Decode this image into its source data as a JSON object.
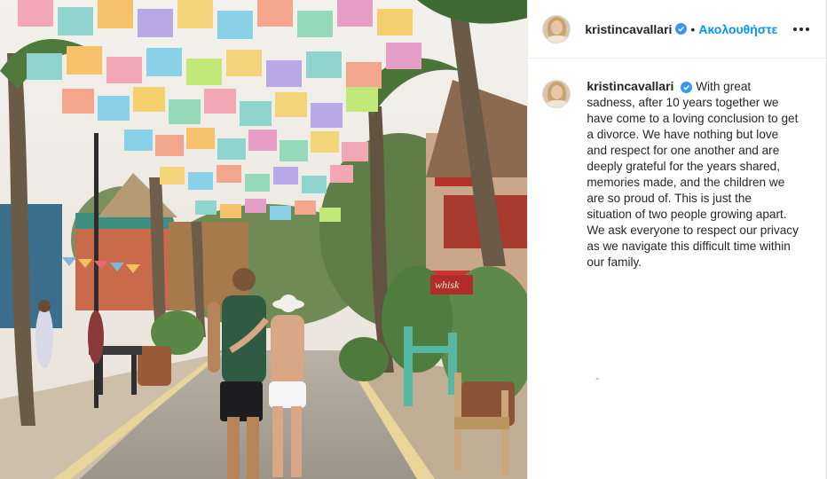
{
  "post": {
    "username": "kristincavallari",
    "follow_label": "Ακολουθήστε",
    "caption": "With great sadness, after 10 years together we have come to a loving conclusion to get a divorce. We have nothing but love and respect for one another and are deeply grateful for the years shared, memories made, and the children we are so proud of. This is just the situation of two people growing apart. We ask everyone to respect our privacy as we navigate this difficult time within our family.",
    "stray_mark": "\""
  },
  "photo": {
    "sign_text": "whisk"
  },
  "icons": {
    "verified": "verified-badge-icon",
    "more": "more-options-icon"
  },
  "colors": {
    "link_blue": "#0095f6",
    "verified_blue": "#3897f0",
    "text": "#262626"
  }
}
